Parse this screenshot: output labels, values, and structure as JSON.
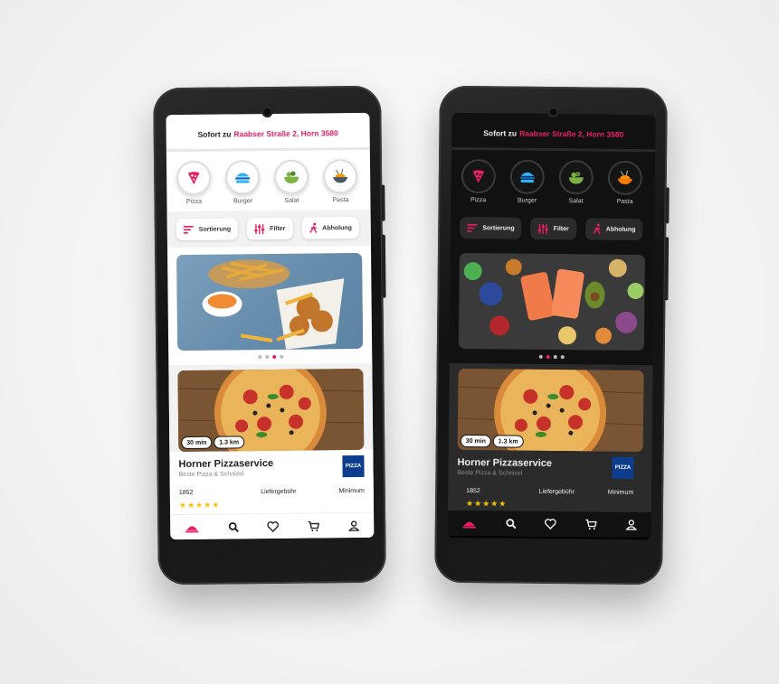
{
  "address": {
    "prefix": "Sofort zu",
    "value": "Raabser Straße 2, Horn 3580"
  },
  "categories": [
    {
      "label": "Pizza",
      "icon": "pizza-icon"
    },
    {
      "label": "Burger",
      "icon": "burger-icon"
    },
    {
      "label": "Salat",
      "icon": "salad-icon"
    },
    {
      "label": "Pasta",
      "icon": "pasta-icon"
    }
  ],
  "filters": [
    {
      "label": "Sortierung",
      "icon": "sort-icon"
    },
    {
      "label": "Filter",
      "icon": "filter-icon"
    },
    {
      "label": "Abholung",
      "icon": "walking-icon"
    }
  ],
  "restaurant": {
    "name": "Horner Pizzaservice",
    "subtitle": "Beste Pizza & Schnizel",
    "time": "30 min",
    "distance": "1.3 km",
    "logo_text": "PIZZA",
    "rating_count": "1852",
    "fee_label": "Liefergebühr",
    "min_label": "Minimum"
  },
  "nav": [
    "home-icon",
    "search-icon",
    "heart-icon",
    "cart-icon",
    "user-icon"
  ],
  "colors": {
    "accent": "#e91e63",
    "dark_bg": "#111111",
    "light_bg": "#ffffff"
  }
}
